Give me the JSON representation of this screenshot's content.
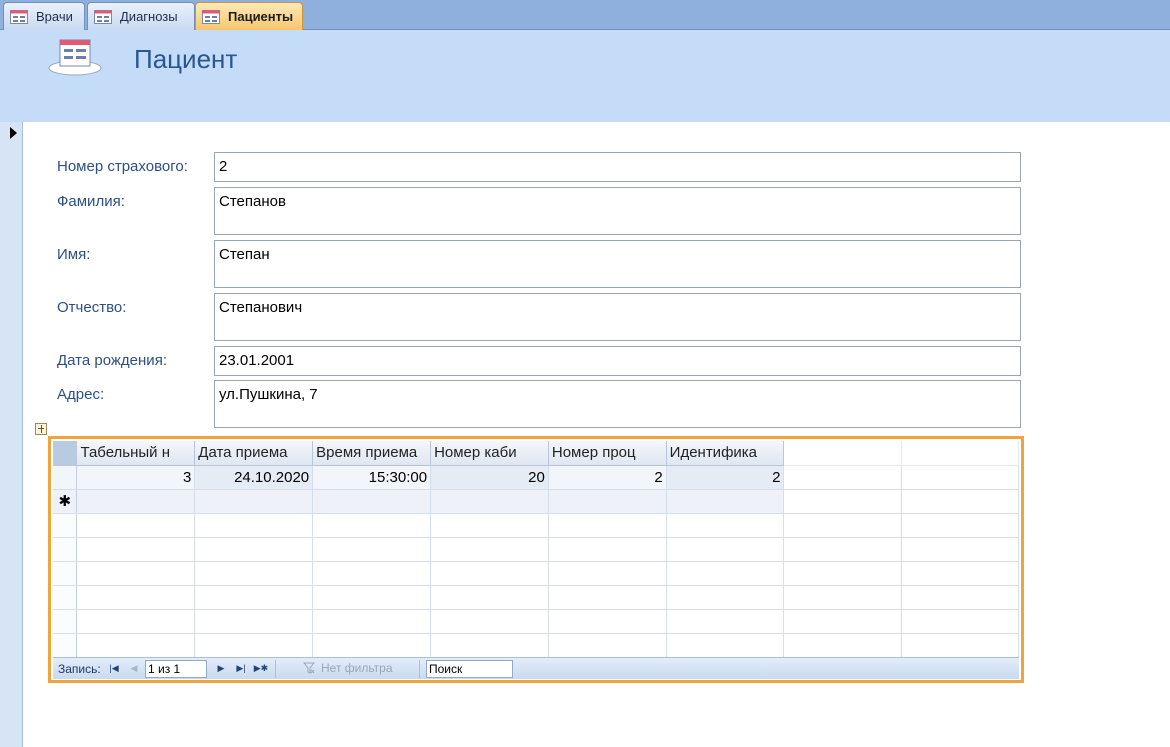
{
  "tabs": [
    {
      "label": "Врачи",
      "active": false
    },
    {
      "label": "Диагнозы",
      "active": false
    },
    {
      "label": "Пациенты",
      "active": true
    }
  ],
  "header": {
    "title": "Пациент"
  },
  "fields": [
    {
      "label": "Номер страхового:",
      "value": "2"
    },
    {
      "label": "Фамилия:",
      "value": "Степанов"
    },
    {
      "label": "Имя:",
      "value": "Степан"
    },
    {
      "label": "Отчество:",
      "value": "Степанович"
    },
    {
      "label": "Дата рождения:",
      "value": "23.01.2001"
    },
    {
      "label": "Адрес:",
      "value": "ул.Пушкина, 7"
    }
  ],
  "subform": {
    "columns": [
      "Табельный н",
      "Дата приема",
      "Время приема",
      "Номер каби",
      "Номер проц",
      "Идентифика"
    ],
    "rows": [
      [
        "3",
        "24.10.2020",
        "15:30:00",
        "20",
        "2",
        "2"
      ]
    ],
    "new_row_marker": "✱"
  },
  "nav": {
    "record_label": "Запись:",
    "current": "1 из 1",
    "filter_label": "Нет фильтра",
    "search_placeholder": "Поиск"
  },
  "colors": {
    "accent": "#f0a43c",
    "header_bg": "#c5dcf8",
    "title": "#2a5694",
    "label": "#2c4f86"
  }
}
